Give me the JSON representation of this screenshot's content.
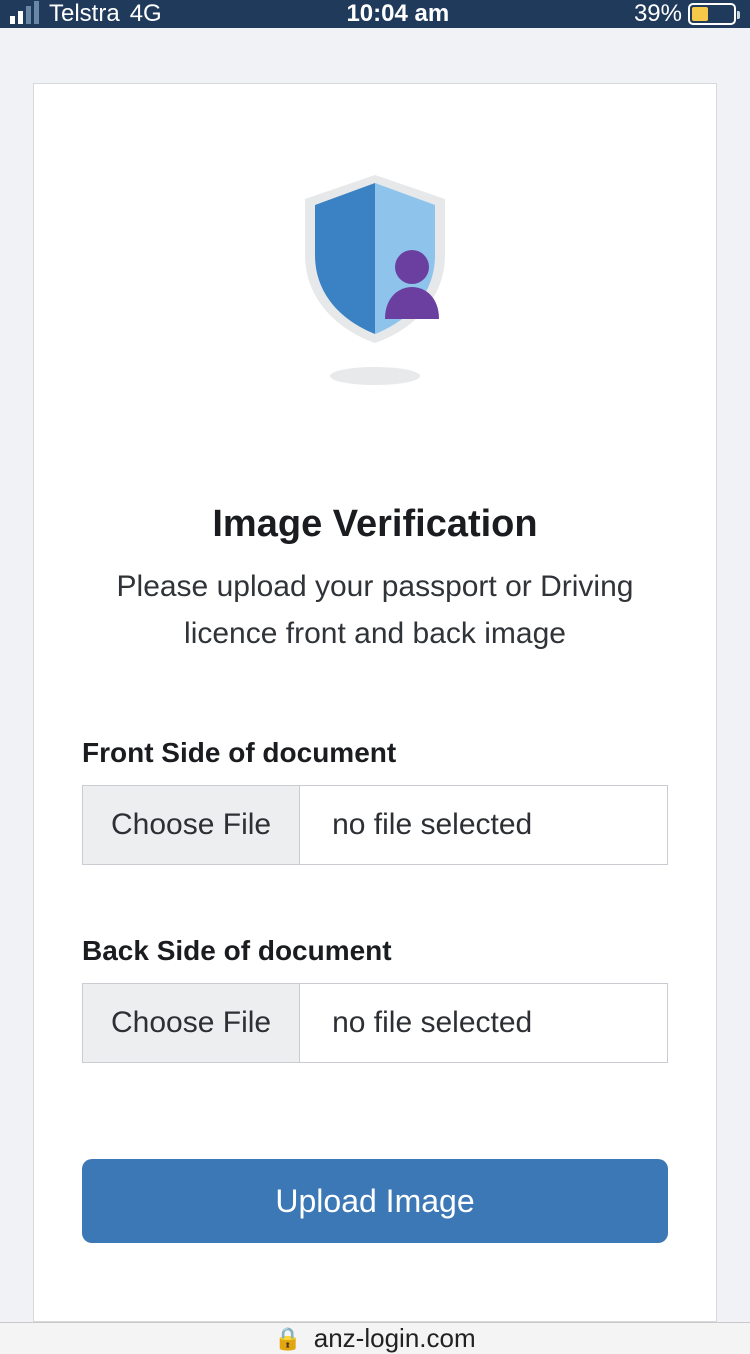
{
  "status_bar": {
    "carrier": "Telstra",
    "network": "4G",
    "time": "10:04 am",
    "battery_pct": "39%"
  },
  "page": {
    "title": "Image Verification",
    "subtitle": "Please upload your passport or Driving licence front and back image",
    "fields": {
      "front": {
        "label": "Front Side of document",
        "button": "Choose File",
        "status": "no file selected"
      },
      "back": {
        "label": "Back Side of document",
        "button": "Choose File",
        "status": "no file selected"
      }
    },
    "submit": "Upload Image"
  },
  "url_bar": {
    "domain": "anz-login.com"
  }
}
